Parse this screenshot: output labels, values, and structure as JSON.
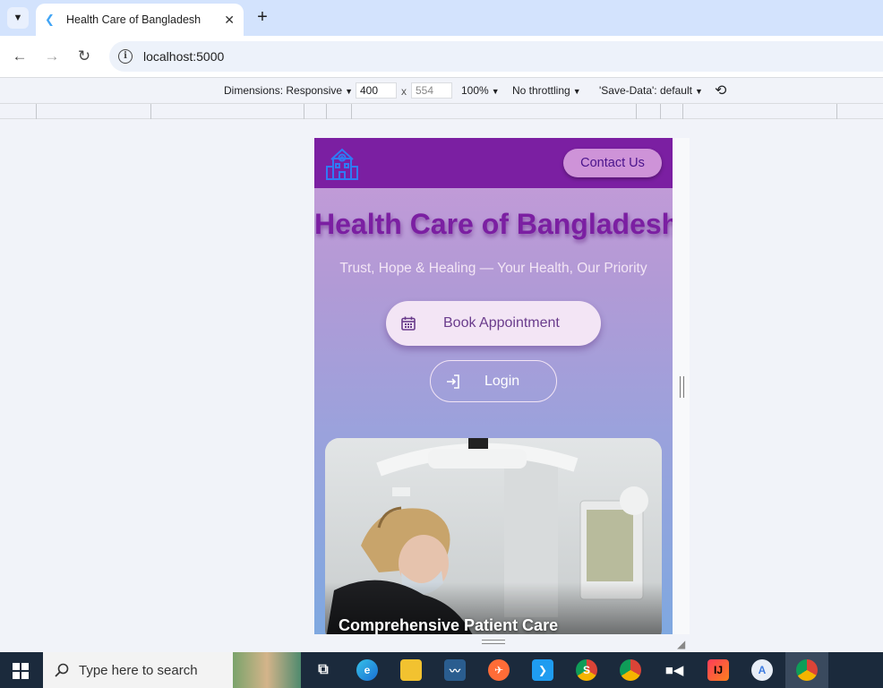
{
  "browser": {
    "tab_title": "Health Care of Bangladesh",
    "tab_close": "✕",
    "new_tab": "+",
    "url": "localhost:5000"
  },
  "devtools": {
    "dimensions_label": "Dimensions: Responsive",
    "width": "400",
    "separator": "x",
    "height": "554",
    "zoom": "100%",
    "throttling": "No throttling",
    "save_data": "'Save-Data': default"
  },
  "app": {
    "contact_button": "Contact Us",
    "title": "Health Care of Bangladesh",
    "subtitle": "Trust, Hope & Healing — Your Health, Our Priority",
    "book_button": "Book Appointment",
    "login_button": "Login",
    "card_caption": "Comprehensive Patient Care",
    "colors": {
      "header": "#7b1fa2",
      "title": "#7b1fa2",
      "contact_button_bg": "#ce93d8",
      "book_button_bg": "#f3e5f5"
    }
  },
  "taskbar": {
    "search_placeholder": "Type here to search",
    "icons": [
      "windows-start-icon",
      "task-view-icon",
      "edge-icon",
      "file-explorer-icon",
      "mysql-workbench-icon",
      "postman-icon",
      "vscode-icon",
      "chrome-profile-icon",
      "chrome-alt-icon",
      "video-icon",
      "intellij-icon",
      "android-studio-icon",
      "chrome-icon"
    ]
  }
}
